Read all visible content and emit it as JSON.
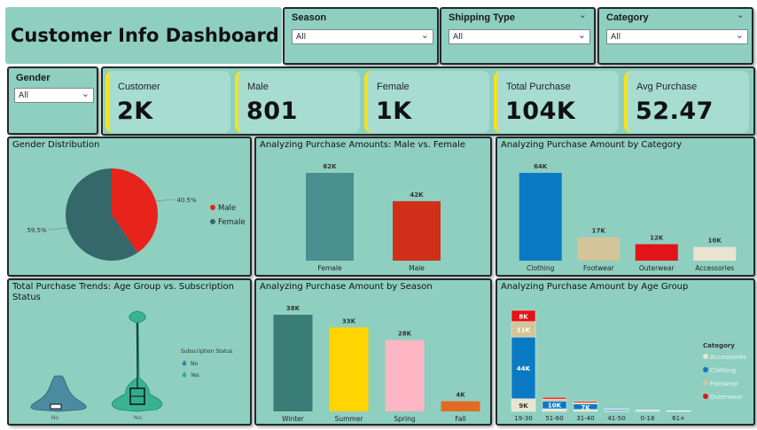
{
  "dashboard_title": "Customer Info Dashboard",
  "slicers": {
    "season": {
      "label": "Season",
      "value": "All"
    },
    "shipping": {
      "label": "Shipping Type",
      "value": "All"
    },
    "category": {
      "label": "Category",
      "value": "All"
    },
    "gender": {
      "label": "Gender",
      "value": "All"
    }
  },
  "kpis": [
    {
      "label": "Customer",
      "value": "2K"
    },
    {
      "label": "Male",
      "value": "801"
    },
    {
      "label": "Female",
      "value": "1K"
    },
    {
      "label": "Total Purchase",
      "value": "104K"
    },
    {
      "label": "Avg Purchase",
      "value": "52.47"
    }
  ],
  "colors": {
    "panel_bg": "#8ecfc0",
    "kpi_bg": "#a7dcd1",
    "kpi_accent": "#f5e21f",
    "male": "#e8231c",
    "female": "#34686a"
  },
  "titles": {
    "gender_distribution": "Gender Distribution",
    "male_vs_female": "Analyzing Purchase Amounts: Male vs. Female",
    "by_category": "Analyzing Purchase Amount by Category",
    "age_sub": "Total Purchase Trends: Age Group vs. Subscription Status",
    "by_season": "Analyzing Purchase Amount by Season",
    "by_age": "Analyzing Purchase Amount by Age Group"
  },
  "chart_data": [
    {
      "id": "gender_pie",
      "type": "pie",
      "title": "Gender Distribution",
      "labels": [
        "Male",
        "Female"
      ],
      "values": [
        40.5,
        59.5
      ],
      "slice_labels": [
        "40.5%",
        "59.5%"
      ],
      "colors": [
        "#e8231c",
        "#34686a"
      ],
      "legend": "right"
    },
    {
      "id": "gender_bar",
      "type": "bar",
      "title": "Analyzing Purchase Amounts: Male vs. Female",
      "categories": [
        "Female",
        "Male"
      ],
      "values": [
        62,
        42
      ],
      "data_labels": [
        "62K",
        "42K"
      ],
      "colors": [
        "#4a9090",
        "#d0301a"
      ],
      "ylim": [
        0,
        62
      ]
    },
    {
      "id": "category_bar",
      "type": "bar",
      "title": "Analyzing Purchase Amount by Category",
      "categories": [
        "Clothing",
        "Footwear",
        "Outerwear",
        "Accessories"
      ],
      "values": [
        64,
        17,
        12,
        10
      ],
      "data_labels": [
        "64K",
        "17K",
        "12K",
        "10K"
      ],
      "colors": [
        "#0a7ac4",
        "#d4c499",
        "#e2141a",
        "#e9e4d0"
      ],
      "ylim": [
        0,
        64
      ]
    },
    {
      "id": "age_subscription_violin",
      "type": "violin",
      "title": "Total Purchase Trends: Age Group vs. Subscription Status",
      "categories": [
        "No",
        "Yes"
      ],
      "legend_title": "Subscription Status",
      "legend": [
        "No",
        "Yes"
      ],
      "colors": [
        "#3e7f9c",
        "#2fae8e"
      ]
    },
    {
      "id": "season_bar",
      "type": "bar",
      "title": "Analyzing Purchase Amount by Season",
      "categories": [
        "Winter",
        "Summer",
        "Spring",
        "Fall"
      ],
      "values": [
        38,
        33,
        28,
        4
      ],
      "data_labels": [
        "38K",
        "33K",
        "28K",
        "4K"
      ],
      "colors": [
        "#3a7c76",
        "#ffd400",
        "#ffb6c4",
        "#e06c23"
      ],
      "ylim": [
        0,
        38
      ]
    },
    {
      "id": "age_stacked_bar",
      "type": "bar",
      "stacked": true,
      "title": "Analyzing Purchase Amount by Age Group",
      "categories": [
        "19-30",
        "51-60",
        "31-40",
        "41-50",
        "0-18",
        "61+"
      ],
      "legend_title": "Category",
      "legend": "right",
      "series": [
        {
          "name": "Clothing",
          "color": "#0a7ac4",
          "values": [
            44,
            5.4,
            3.8,
            0.9,
            0.4,
            0.2
          ],
          "data_labels": [
            "44K",
            "10K",
            "7K",
            "",
            "",
            ""
          ]
        },
        {
          "name": "Footwear",
          "color": "#d4c499",
          "values": [
            11,
            1.5,
            1,
            0.3,
            0.15,
            0.05
          ],
          "data_labels": [
            "11K",
            "",
            "",
            "",
            "",
            ""
          ]
        },
        {
          "name": "Outerwear",
          "color": "#e2141a",
          "values": [
            8,
            1.2,
            0.8,
            0.2,
            0.1,
            0.05
          ],
          "data_labels": [
            "8K",
            "",
            "",
            "",
            "",
            ""
          ]
        },
        {
          "name": "Accessories",
          "color": "#e9e4d0",
          "values": [
            9,
            1.9,
            1.4,
            0.4,
            0.2,
            0.1
          ],
          "data_labels": [
            "9K",
            "",
            "",
            "",
            "",
            ""
          ]
        }
      ],
      "legend_order": [
        "Accessories",
        "Clothing",
        "Footwear",
        "Outerwear"
      ],
      "ylim": [
        0,
        72
      ]
    }
  ]
}
